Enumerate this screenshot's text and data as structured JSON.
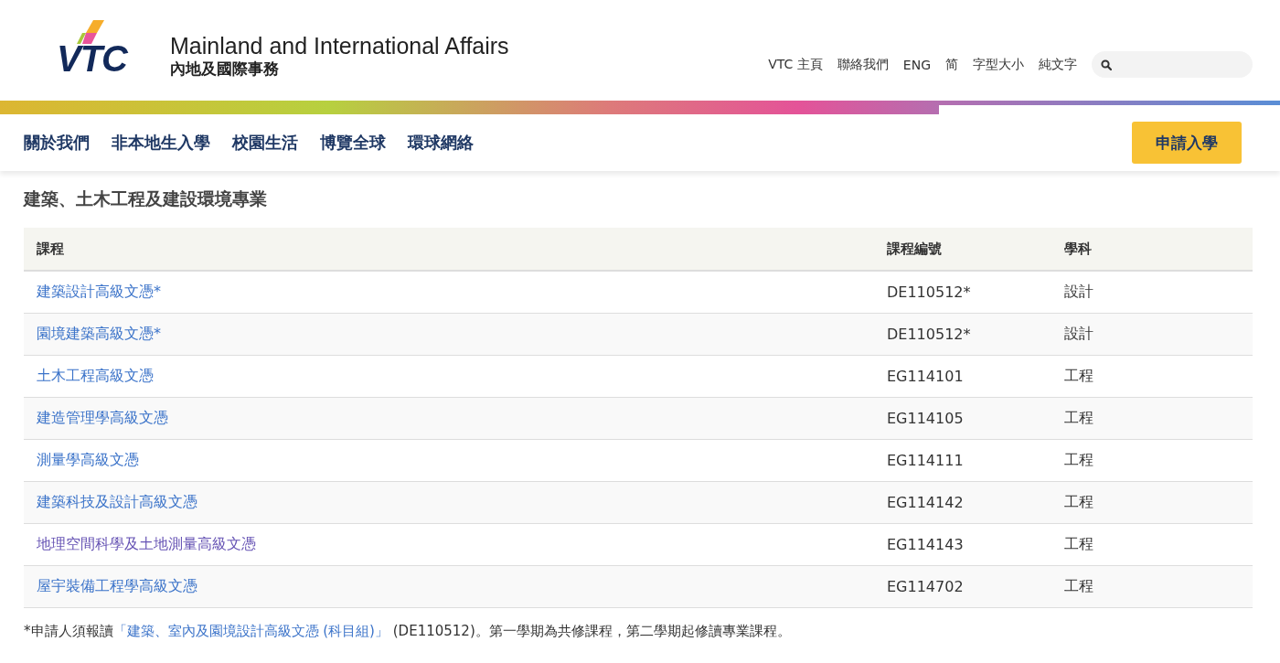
{
  "header": {
    "logo": "VTC",
    "title_en": "Mainland and International Affairs",
    "title_zh": "內地及國際事務",
    "utility_links": [
      "VTC 主頁",
      "聯絡我們",
      "ENG",
      "简",
      "字型大小",
      "純文字"
    ]
  },
  "nav": {
    "items": [
      "關於我們",
      "非本地生入學",
      "校園生活",
      "博覽全球",
      "環球網絡"
    ],
    "apply_button": "申請入學"
  },
  "section_title": "建築、土木工程及建設環境專業",
  "table": {
    "columns": [
      "課程",
      "課程編號",
      "學科"
    ],
    "rows": [
      {
        "course": "建築設計高級文憑*",
        "code": "DE110512*",
        "subject": "設計",
        "visited": false
      },
      {
        "course": "園境建築高級文憑*",
        "code": "DE110512*",
        "subject": "設計",
        "visited": false
      },
      {
        "course": "土木工程高級文憑",
        "code": "EG114101",
        "subject": "工程",
        "visited": false
      },
      {
        "course": "建造管理學高級文憑",
        "code": "EG114105",
        "subject": "工程",
        "visited": false
      },
      {
        "course": "測量學高級文憑",
        "code": "EG114111",
        "subject": "工程",
        "visited": false
      },
      {
        "course": "建築科技及設計高級文憑",
        "code": "EG114142",
        "subject": "工程",
        "visited": false
      },
      {
        "course": "地理空間科學及土地測量高級文憑",
        "code": "EG114143",
        "subject": "工程",
        "visited": true
      },
      {
        "course": "屋宇裝備工程學高級文憑",
        "code": "EG114702",
        "subject": "工程",
        "visited": false
      }
    ]
  },
  "footnote": {
    "prefix": "*申請人須報讀",
    "link": "「建築、室內及園境設計高級文憑 (科目組)」",
    "suffix": " (DE110512)。第一學期為共修課程，第二學期起修讀專業課程。"
  }
}
